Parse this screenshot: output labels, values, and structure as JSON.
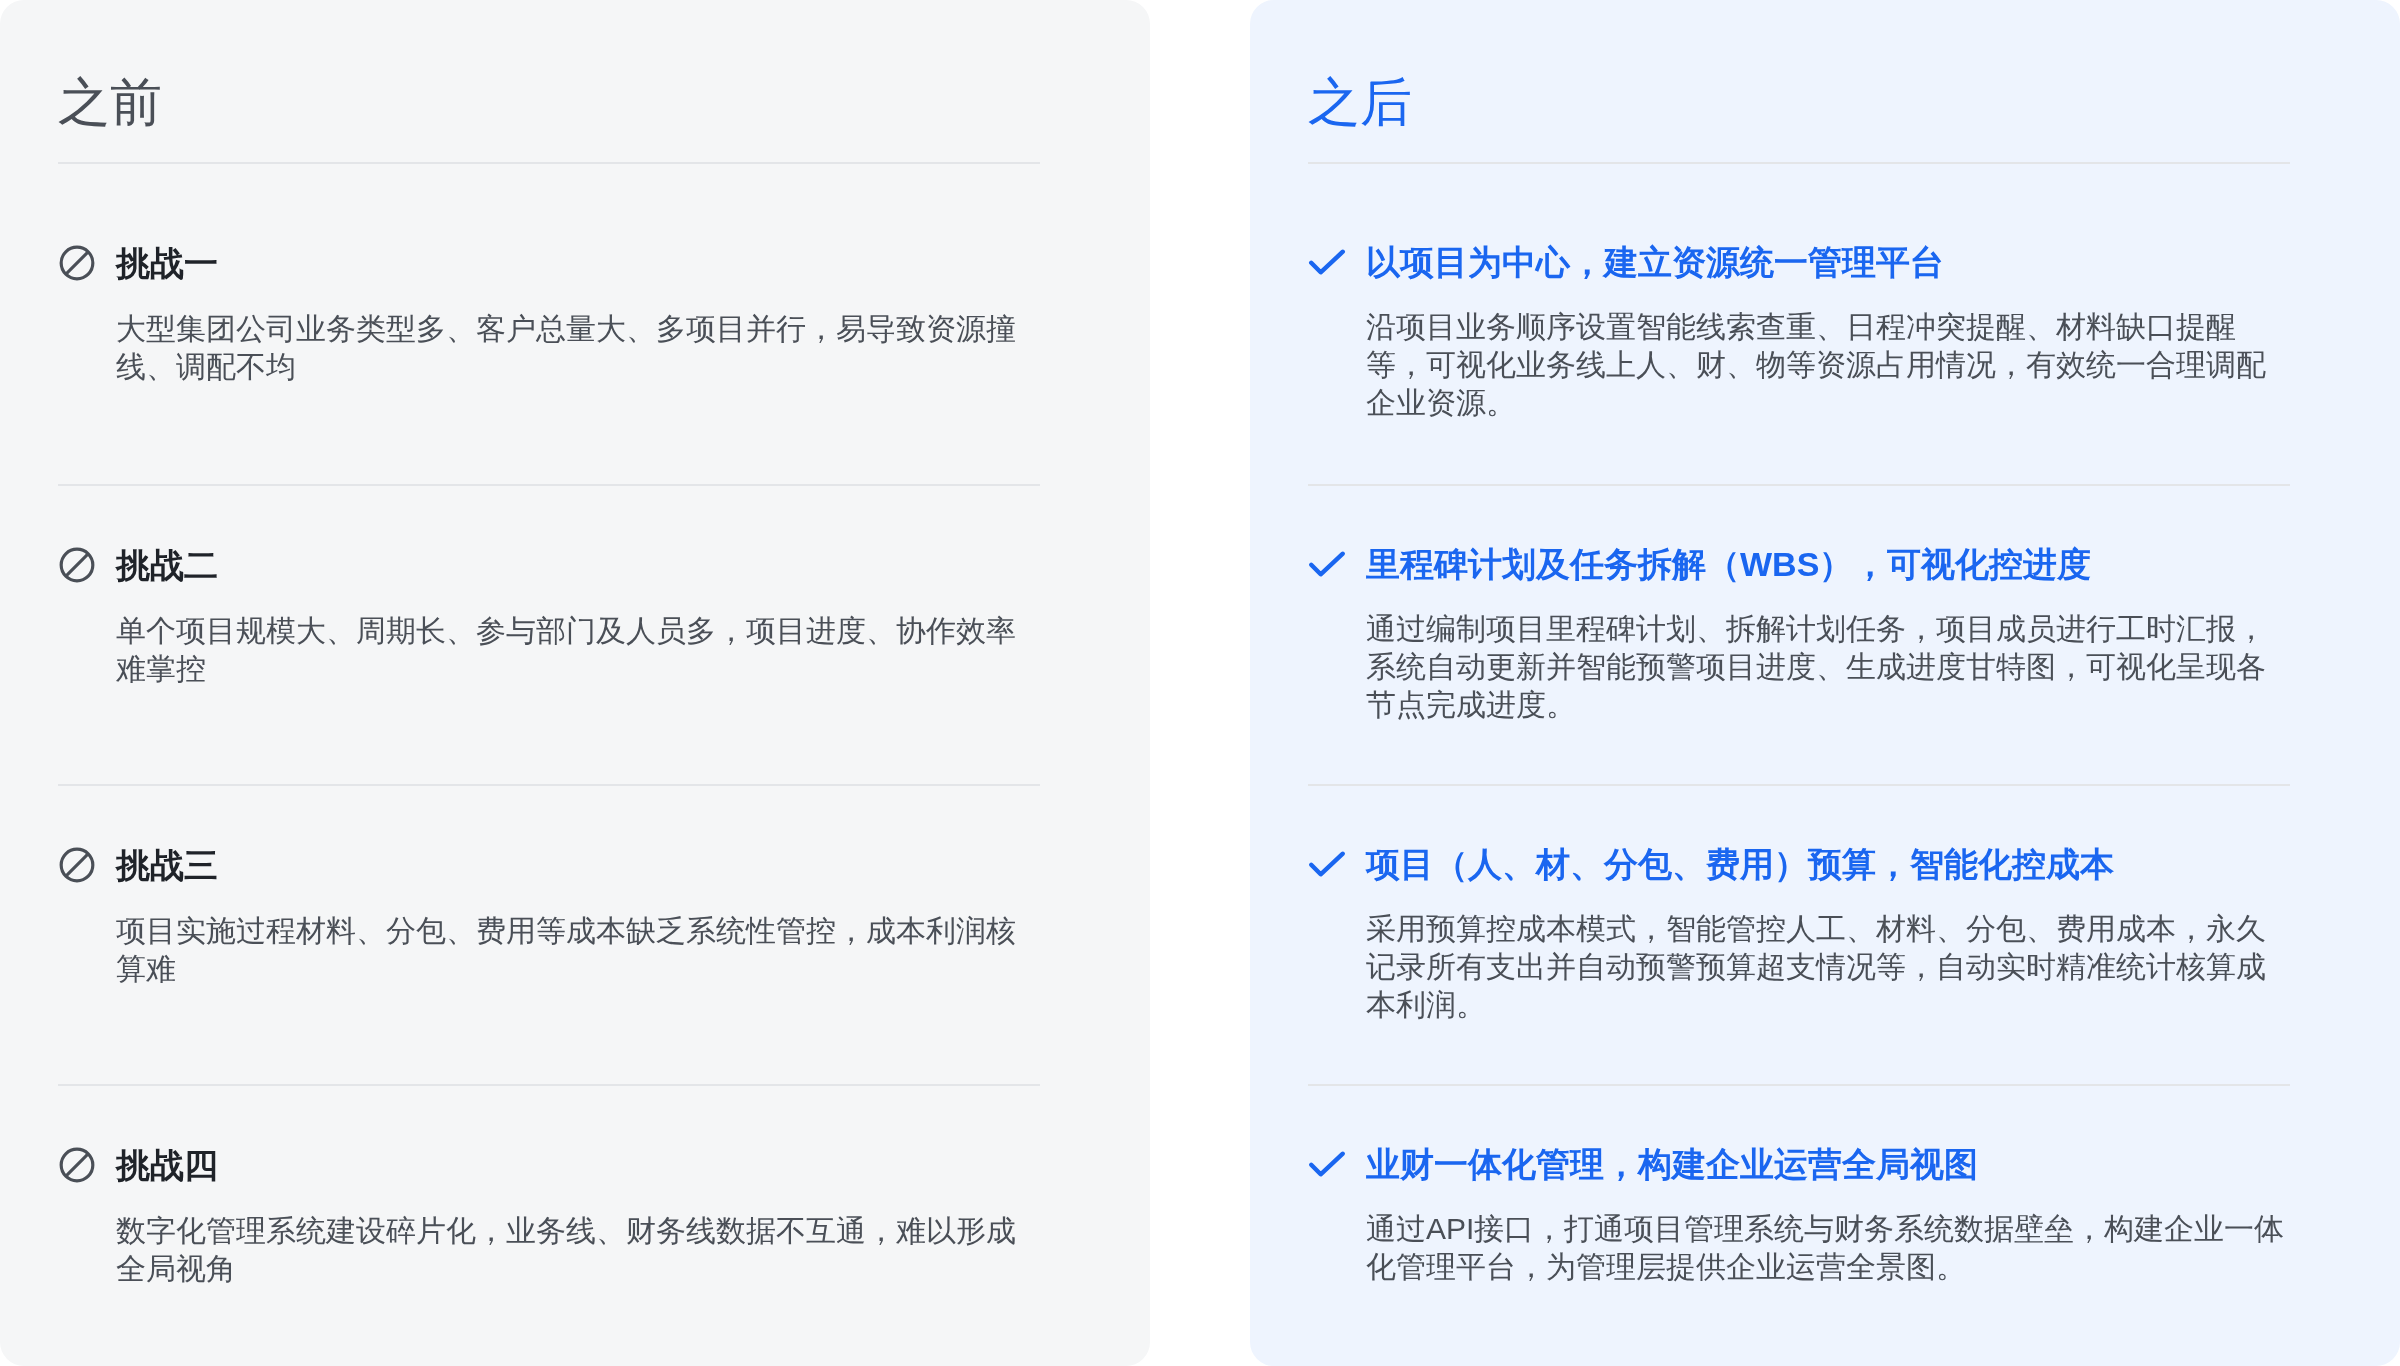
{
  "panels": [
    {
      "kind": "before",
      "title": "之前",
      "items": [
        {
          "title": "挑战一",
          "description": "大型集团公司业务类型多、客户总量大、多项目并行，易导致资源撞线、调配不均"
        },
        {
          "title": "挑战二",
          "description": "单个项目规模大、周期长、参与部门及人员多，项目进度、协作效率难掌控"
        },
        {
          "title": "挑战三",
          "description": "项目实施过程材料、分包、费用等成本缺乏系统性管控，成本利润核算难"
        },
        {
          "title": "挑战四",
          "description": "数字化管理系统建设碎片化，业务线、财务线数据不互通，难以形成全局视角"
        }
      ]
    },
    {
      "kind": "after",
      "title": "之后",
      "items": [
        {
          "title": "以项目为中心，建立资源统一管理平台",
          "description": "沿项目业务顺序设置智能线索查重、日程冲突提醒、材料缺口提醒等，可视化业务线上人、财、物等资源占用情况，有效统一合理调配企业资源。"
        },
        {
          "title": "里程碑计划及任务拆解（WBS），可视化控进度",
          "description": "通过编制项目里程碑计划、拆解计划任务，项目成员进行工时汇报，系统自动更新并智能预警项目进度、生成进度甘特图，可视化呈现各节点完成进度。"
        },
        {
          "title": "项目（人、材、分包、费用）预算，智能化控成本",
          "description": "采用预算控成本模式，智能管控人工、材料、分包、费用成本，永久记录所有支出并自动预警预算超支情况等，自动实时精准统计核算成本利润。"
        },
        {
          "title": "业财一体化管理，构建企业运营全局视图",
          "description": "通过API接口，打通项目管理系统与财务系统数据壁垒，构建企业一体化管理平台，为管理层提供企业运营全景图。"
        }
      ]
    }
  ]
}
